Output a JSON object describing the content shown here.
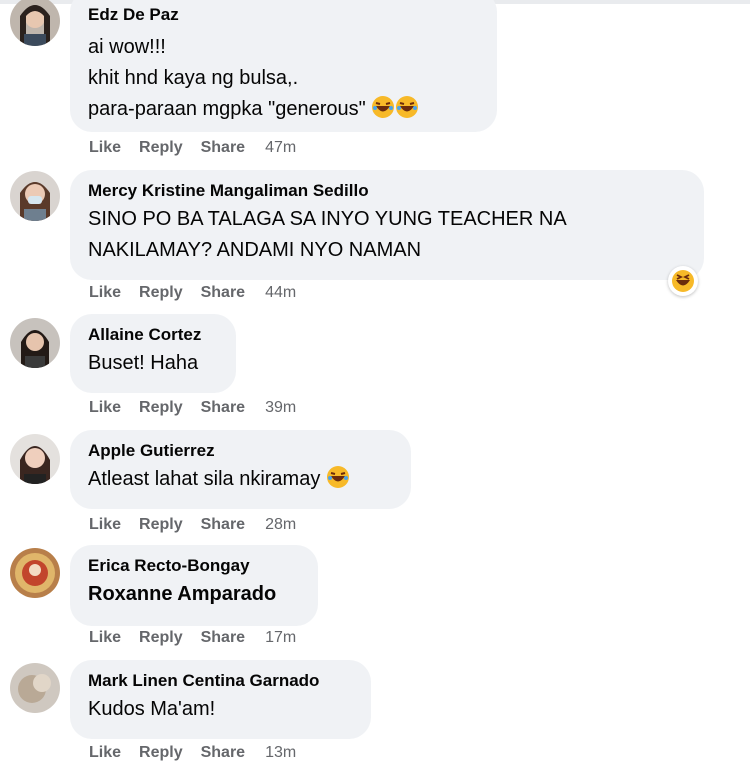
{
  "actions": {
    "like": "Like",
    "reply": "Reply",
    "share": "Share"
  },
  "comments": [
    {
      "author": "Edz De Paz",
      "lines": [
        "ai wow!!!",
        "khit hnd kaya ng bulsa,.",
        "para-paraan mgpka \"generous\""
      ],
      "time": "47m"
    },
    {
      "author": "Mercy Kristine Mangaliman Sedillo",
      "lines": [
        "SINO PO BA TALAGA SA INYO YUNG TEACHER NA",
        "NAKILAMAY? ANDAMI NYO NAMAN"
      ],
      "time": "44m"
    },
    {
      "author": "Allaine Cortez",
      "lines": [
        "Buset! Haha"
      ],
      "time": "39m"
    },
    {
      "author": "Apple Gutierrez",
      "lines": [
        "Atleast lahat sila nkiramay"
      ],
      "time": "28m"
    },
    {
      "author": "Erica Recto-Bongay",
      "lines": [
        "Roxanne Amparado"
      ],
      "time": "17m"
    },
    {
      "author": "Mark Linen Centina Garnado",
      "lines": [
        "Kudos Ma'am!"
      ],
      "time": "13m"
    }
  ],
  "colors": {
    "bubble": "#f0f2f5",
    "meta": "#65676b",
    "text": "#050505",
    "emoji": "#f7b928"
  },
  "icons": {
    "laugh": "laughing-emoji",
    "haha_reaction": "haha-reaction-icon"
  }
}
